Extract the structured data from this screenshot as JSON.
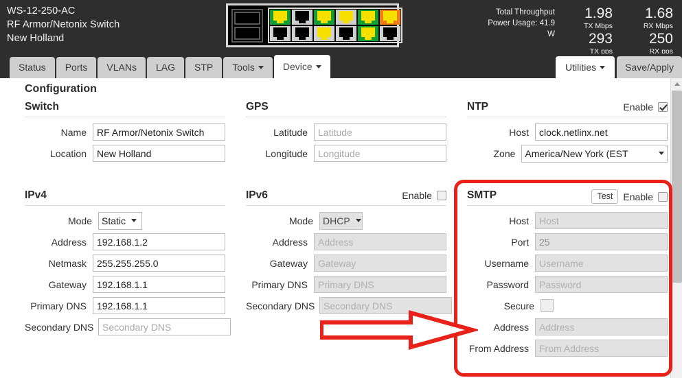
{
  "header": {
    "device_model": "WS-12-250-AC",
    "device_name": "RF Armor/Netonix Switch",
    "device_location": "New Holland",
    "throughput_label": "Total Throughput",
    "power_usage_label": "Power Usage: 41.9 W",
    "tx_mbps_value": "1.98",
    "tx_mbps_label": "TX Mbps",
    "tx_pps_value": "293",
    "tx_pps_label": "TX pps",
    "rx_mbps_value": "1.68",
    "rx_mbps_label": "RX Mbps",
    "rx_pps_value": "250",
    "rx_pps_label": "RX pps"
  },
  "ports": {
    "sfp": [
      {
        "state": "off"
      },
      {
        "state": "off"
      }
    ],
    "top_row": [
      {
        "frame": "frame-green",
        "plug": "plug-yellow"
      },
      {
        "frame": "frame-gray",
        "plug": "plug-black"
      },
      {
        "frame": "frame-green",
        "plug": "plug-yellow"
      },
      {
        "frame": "frame-gray",
        "plug": "plug-yellow"
      },
      {
        "frame": "frame-green",
        "plug": "plug-yellow"
      },
      {
        "frame": "frame-orange",
        "plug": "plug-yellow"
      }
    ],
    "bottom_row": [
      {
        "frame": "frame-gray",
        "plug": "plug-black"
      },
      {
        "frame": "frame-gray",
        "plug": "plug-black"
      },
      {
        "frame": "frame-gray",
        "plug": "plug-yellow"
      },
      {
        "frame": "frame-gray",
        "plug": "plug-black"
      },
      {
        "frame": "frame-green",
        "plug": "plug-yellow"
      },
      {
        "frame": "frame-gray",
        "plug": "plug-black"
      }
    ]
  },
  "nav": {
    "tabs": [
      {
        "label": "Status",
        "active": false,
        "caret": false
      },
      {
        "label": "Ports",
        "active": false,
        "caret": false
      },
      {
        "label": "VLANs",
        "active": false,
        "caret": false
      },
      {
        "label": "LAG",
        "active": false,
        "caret": false
      },
      {
        "label": "STP",
        "active": false,
        "caret": false
      },
      {
        "label": "Tools",
        "active": false,
        "caret": true
      },
      {
        "label": "Device",
        "active": true,
        "caret": true
      }
    ],
    "utilities_label": "Utilities",
    "save_apply_label": "Save/Apply"
  },
  "page": {
    "title": "Configuration"
  },
  "switch": {
    "title": "Switch",
    "name_label": "Name",
    "name_value": "RF Armor/Netonix Switch",
    "location_label": "Location",
    "location_value": "New Holland"
  },
  "ipv4": {
    "title": "IPv4",
    "mode_label": "Mode",
    "mode_value": "Static",
    "address_label": "Address",
    "address_value": "192.168.1.2",
    "netmask_label": "Netmask",
    "netmask_value": "255.255.255.0",
    "gateway_label": "Gateway",
    "gateway_value": "192.168.1.1",
    "primary_dns_label": "Primary DNS",
    "primary_dns_value": "192.168.1.1",
    "secondary_dns_label": "Secondary DNS",
    "secondary_dns_placeholder": "Secondary DNS"
  },
  "gps": {
    "title": "GPS",
    "latitude_label": "Latitude",
    "latitude_placeholder": "Latitude",
    "longitude_label": "Longitude",
    "longitude_placeholder": "Longitude"
  },
  "ipv6": {
    "title": "IPv6",
    "enable_label": "Enable",
    "enabled": false,
    "mode_label": "Mode",
    "mode_value": "DHCP",
    "address_label": "Address",
    "address_placeholder": "Address",
    "gateway_label": "Gateway",
    "gateway_placeholder": "Gateway",
    "primary_dns_label": "Primary DNS",
    "primary_dns_placeholder": "Primary DNS",
    "secondary_dns_label": "Secondary DNS",
    "secondary_dns_placeholder": "Secondary DNS"
  },
  "ntp": {
    "title": "NTP",
    "enable_label": "Enable",
    "enabled": true,
    "host_label": "Host",
    "host_value": "clock.netlinx.net",
    "zone_label": "Zone",
    "zone_value": "America/New York (EST"
  },
  "smtp": {
    "title": "SMTP",
    "test_label": "Test",
    "enable_label": "Enable",
    "enabled": false,
    "host_label": "Host",
    "host_placeholder": "Host",
    "port_label": "Port",
    "port_value": "25",
    "username_label": "Username",
    "username_placeholder": "Username",
    "password_label": "Password",
    "password_placeholder": "Password",
    "secure_label": "Secure",
    "secure_checked": false,
    "address_label": "Address",
    "address_placeholder": "Address",
    "from_address_label": "From Address",
    "from_address_placeholder": "From Address"
  },
  "annotations": {
    "highlight_color": "#e8211b",
    "arrow_color": "#e8211b"
  }
}
